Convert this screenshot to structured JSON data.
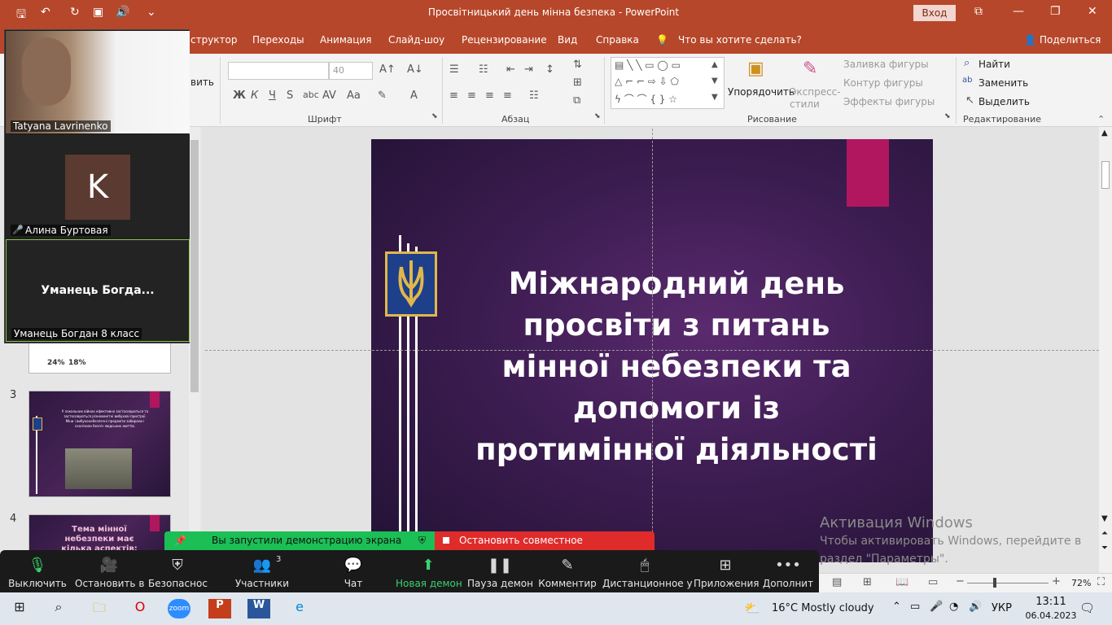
{
  "window": {
    "title": "Просвітницький день мінна безпека - PowerPoint",
    "signin_label": "Вход"
  },
  "tabs": [
    "структор",
    "Переходы",
    "Анимация",
    "Слайд-шоу",
    "Рецензирование",
    "Вид",
    "Справка"
  ],
  "tell_me": "Что вы хотите сделать?",
  "share_label": "Поделиться",
  "ribbon": {
    "left_cut_label": "вить",
    "font_size": "40",
    "font_group": "Шрифт",
    "paragraph_group": "Абзац",
    "drawing_group": "Рисование",
    "editing_group": "Редактирование",
    "arrange_label": "Упорядочить",
    "quick_styles_label": "Экспресс-стили",
    "shape_fill": "Заливка фигуры",
    "shape_outline": "Контур фигуры",
    "shape_effects": "Эффекты фигуры",
    "find": "Найти",
    "replace": "Заменить",
    "select": "Выделить"
  },
  "thumbnails": [
    {
      "num": "3",
      "text": "У локальних війнах ефективно застосовуються та застосовуються різноманітні вибухові пристрої. Міни і вибухонебезпечні предмети забирали і скалічили безліч людських життів."
    },
    {
      "num": "4",
      "text": "Тема мінної небезпеки має кілька аспектів: Перший - це національна"
    }
  ],
  "thumb_partial": {
    "stat1": "24%",
    "stat2": "18%"
  },
  "slide": {
    "title_lines": [
      "Міжнародний день",
      "просвіти з питань",
      "мінної небезпеки та",
      "допомоги із",
      "протимінної діяльності"
    ]
  },
  "zoom": {
    "participants": [
      {
        "name": "Tatyana Lavrinenko"
      },
      {
        "name": "Алина Буртовая",
        "initial": "K"
      },
      {
        "name": "Уманець Богдан 8 класс",
        "display": "Уманець  Богда..."
      }
    ],
    "share_notice": "Вы запустили демонстрацию экрана",
    "stop_share": "Остановить совместное использование",
    "toolbar": [
      {
        "label": "Выключить"
      },
      {
        "label": "Остановить в"
      },
      {
        "label": "Безопаснос"
      },
      {
        "label": "Участники",
        "count": "3"
      },
      {
        "label": "Чат"
      },
      {
        "label": "Новая демон"
      },
      {
        "label": "Пауза демон"
      },
      {
        "label": "Комментир"
      },
      {
        "label": "Дистанционное у"
      },
      {
        "label": "Приложения"
      },
      {
        "label": "Дополнит"
      }
    ]
  },
  "activation": {
    "title": "Активация Windows",
    "line1": "Чтобы активировать Windows, перейдите в",
    "line2": "раздел \"Параметры\"."
  },
  "statusbar": {
    "zoom": "72%"
  },
  "taskbar": {
    "weather": "16°C  Mostly cloudy",
    "lang": "УКР",
    "time": "13:11",
    "date": "06.04.2023"
  },
  "colors": {
    "accent": "#b7472a",
    "zoom_green": "#1bbf55",
    "zoom_red": "#e02b2b",
    "slide_pink": "#b0175f"
  }
}
